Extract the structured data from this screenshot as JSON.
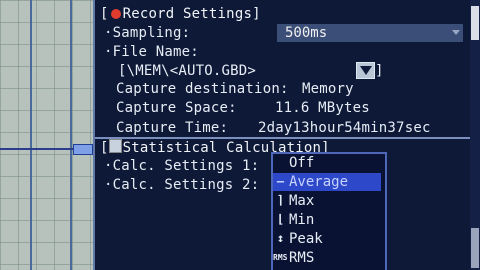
{
  "record": {
    "header_prefix": "[",
    "header_title": "Record Settings]",
    "sampling_label": "·Sampling:",
    "sampling_value": "500ms",
    "file_name_label": "·File Name:",
    "file_path_open": "[\\MEM\\<AUTO.GBD>",
    "file_path_close": "]",
    "capture_destination_label": "Capture destination:",
    "capture_destination_value": "Memory",
    "capture_space_label": "Capture Space:",
    "capture_space_value": "11.6 MBytes",
    "capture_time_label": "Capture Time:",
    "capture_time_value": "2day13hour54min37sec"
  },
  "statistical": {
    "header_prefix": "[",
    "header_title": "Statistical Calculation]",
    "calc1_label": "·Calc. Settings 1:",
    "calc2_label": "·Calc. Settings 2:"
  },
  "popup": {
    "options": [
      {
        "label": "Off",
        "icon": ""
      },
      {
        "label": "Average",
        "icon": "—"
      },
      {
        "label": "Max",
        "icon": "⌉"
      },
      {
        "label": "Min",
        "icon": "⌊"
      },
      {
        "label": "Peak",
        "icon": "↕"
      },
      {
        "label": "RMS",
        "icon": "RMS"
      }
    ],
    "selected_index": 1
  },
  "colors": {
    "panel_background": "#0e1837",
    "selection": "#2d49c9",
    "record_dot": "#e03b2f"
  }
}
